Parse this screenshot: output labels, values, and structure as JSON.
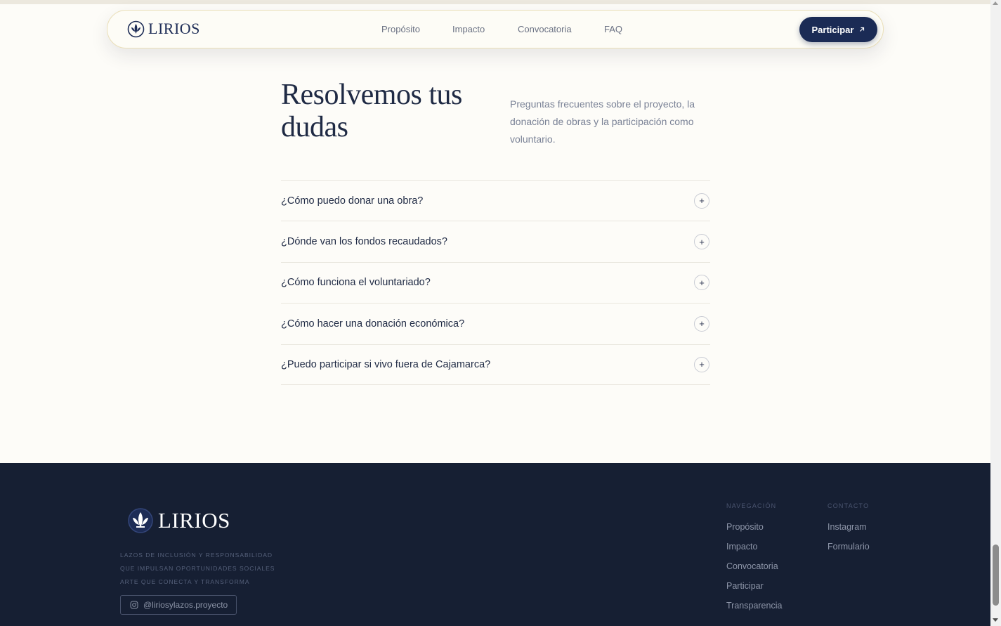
{
  "navbar": {
    "brand": "LIRIOS",
    "links": [
      "Propósito",
      "Impacto",
      "Convocatoria",
      "FAQ"
    ],
    "cta_label": "Participar",
    "cta_icon": "arrow-up-right-icon"
  },
  "faq": {
    "title": "Resolvemos tus dudas",
    "subtitle": "Preguntas frecuentes sobre el proyecto, la donación de obras y la participación como voluntario.",
    "items": [
      "¿Cómo puedo donar una obra?",
      "¿Dónde van los fondos recaudados?",
      "¿Cómo funciona el voluntariado?",
      "¿Cómo hacer una donación económica?",
      "¿Puedo participar si vivo fuera de Cajamarca?"
    ],
    "expand_symbol": "+"
  },
  "footer": {
    "brand": "LIRIOS",
    "taglines": [
      "Lazos de inclusión y responsabilidad",
      "que impulsan oportunidades sociales",
      "arte que conecta y transforma"
    ],
    "instagram_handle": "@liriosylazos.proyecto",
    "nav_heading": "Navegación",
    "nav_links": [
      "Propósito",
      "Impacto",
      "Convocatoria",
      "Participar",
      "Transparencia"
    ],
    "contact_heading": "Contacto",
    "contact_links": [
      "Instagram",
      "Formulario"
    ]
  },
  "colors": {
    "background": "#fdfcf8",
    "navy": "#1b2b55",
    "footer_bg": "#161f33",
    "muted_text": "#7a8296"
  }
}
